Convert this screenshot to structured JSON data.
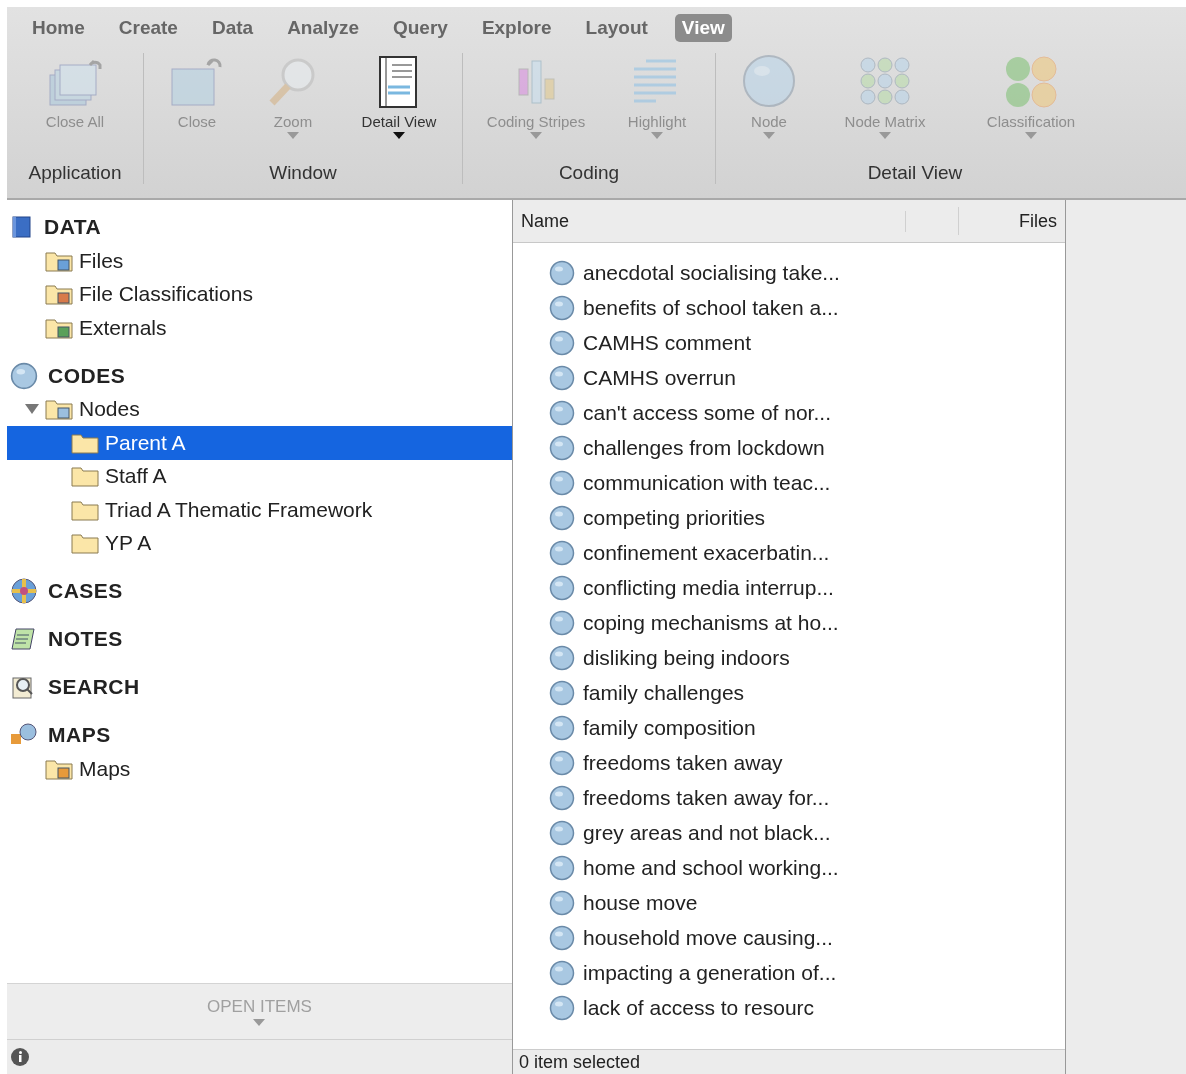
{
  "menu_tabs": [
    {
      "label": "Home",
      "selected": false
    },
    {
      "label": "Create",
      "selected": false
    },
    {
      "label": "Data",
      "selected": false
    },
    {
      "label": "Analyze",
      "selected": false
    },
    {
      "label": "Query",
      "selected": false
    },
    {
      "label": "Explore",
      "selected": false
    },
    {
      "label": "Layout",
      "selected": false
    },
    {
      "label": "View",
      "selected": true
    }
  ],
  "ribbon_groups": [
    {
      "label": "Application",
      "buttons": [
        {
          "label": "Close All",
          "kind": "stack",
          "disabled": true,
          "dropdown": false
        }
      ]
    },
    {
      "label": "Window",
      "buttons": [
        {
          "label": "Close",
          "kind": "window",
          "disabled": true,
          "dropdown": false
        },
        {
          "label": "Zoom",
          "kind": "zoom",
          "disabled": true,
          "dropdown": true
        },
        {
          "label": "Detail View",
          "kind": "detail",
          "disabled": false,
          "dropdown": true
        }
      ]
    },
    {
      "label": "Coding",
      "buttons": [
        {
          "label": "Coding Stripes",
          "kind": "stripes",
          "disabled": true,
          "dropdown": true
        },
        {
          "label": "Highlight",
          "kind": "highlight",
          "disabled": true,
          "dropdown": true
        }
      ]
    },
    {
      "label": "Detail View",
      "buttons": [
        {
          "label": "Node",
          "kind": "node",
          "disabled": true,
          "dropdown": true
        },
        {
          "label": "Node Matrix",
          "kind": "matrix",
          "disabled": true,
          "dropdown": true
        },
        {
          "label": "Classification",
          "kind": "classification",
          "disabled": true,
          "dropdown": true
        }
      ]
    }
  ],
  "sidebar": {
    "sections": [
      {
        "label": "DATA",
        "kind": "data",
        "items": [
          {
            "label": "Files",
            "kind": "files",
            "selected": false
          },
          {
            "label": "File Classifications",
            "kind": "classes",
            "selected": false
          },
          {
            "label": "Externals",
            "kind": "externals",
            "selected": false
          }
        ]
      },
      {
        "label": "CODES",
        "kind": "codes",
        "items": [
          {
            "label": "Nodes",
            "kind": "nodes",
            "selected": false,
            "expanded": true,
            "children": [
              {
                "label": "Parent A",
                "kind": "folder",
                "selected": true
              },
              {
                "label": "Staff A",
                "kind": "folder",
                "selected": false
              },
              {
                "label": "Triad A Thematic Framework",
                "kind": "folder",
                "selected": false
              },
              {
                "label": "YP A",
                "kind": "folder",
                "selected": false
              }
            ]
          }
        ]
      },
      {
        "label": "CASES",
        "kind": "cases"
      },
      {
        "label": "NOTES",
        "kind": "notes"
      },
      {
        "label": "SEARCH",
        "kind": "search"
      },
      {
        "label": "MAPS",
        "kind": "maps",
        "items": [
          {
            "label": "Maps",
            "kind": "mapsfolder",
            "selected": false
          }
        ]
      }
    ],
    "open_items": "OPEN ITEMS"
  },
  "list": {
    "columns": [
      "Name",
      "Files"
    ],
    "rows": [
      "anecdotal socialising take...",
      "benefits of school taken a...",
      "CAMHS comment",
      "CAMHS overrun",
      "can't access some of nor...",
      "challenges from lockdown",
      "communication with teac...",
      "competing priorities",
      "confinement exacerbatin...",
      "conflicting media interrup...",
      "coping mechanisms at ho...",
      "disliking being indoors",
      "family challenges",
      "family composition",
      "freedoms taken away",
      "freedoms taken away for...",
      "grey areas and not black...",
      "home and school working...",
      "house move",
      "household move causing...",
      "impacting a generation of...",
      "lack of access to resourc"
    ],
    "status": "0 item selected"
  }
}
